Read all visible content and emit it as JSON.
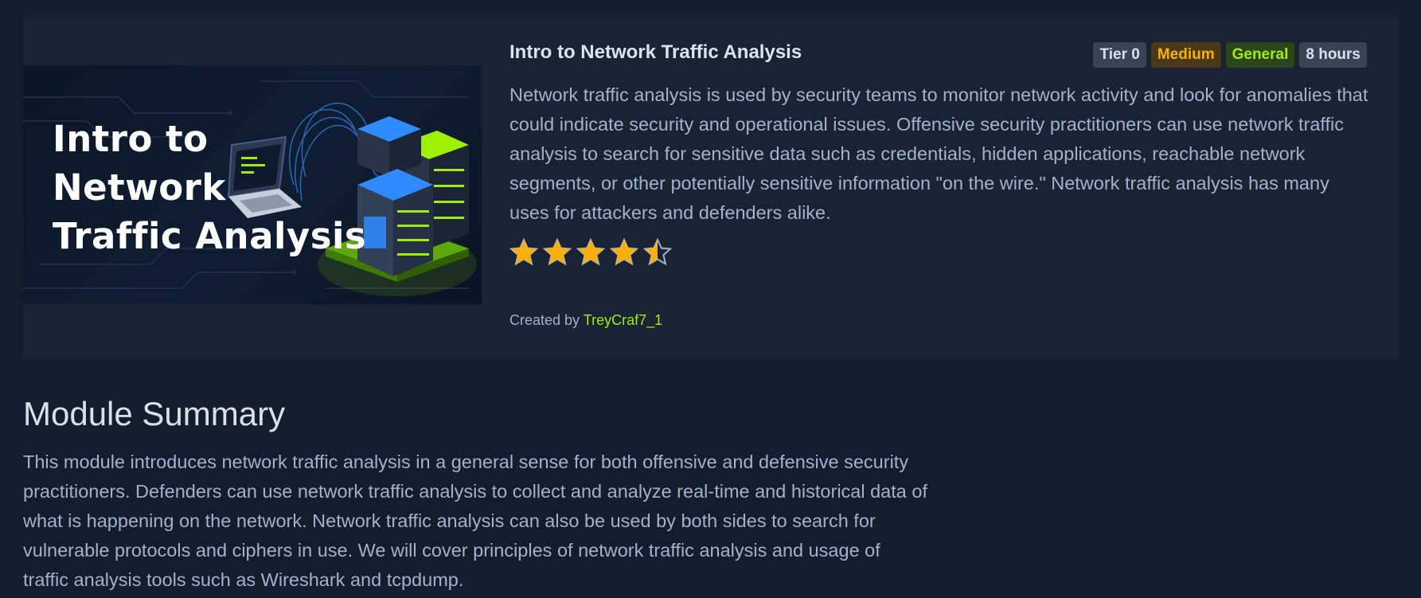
{
  "module": {
    "title": "Intro to Network Traffic Analysis",
    "thumbnail": {
      "line1": "Intro to",
      "line2": "Network",
      "line3": "Traffic Analysis"
    },
    "badges": {
      "tier": "Tier 0",
      "difficulty": "Medium",
      "category": "General",
      "duration": "8 hours"
    },
    "description": "Network traffic analysis is used by security teams to monitor network activity and look for anomalies that could indicate security and operational issues. Offensive security practitioners can use network traffic analysis to search for sensitive data such as credentials, hidden applications, reachable network segments, or other potentially sensitive information \"on the wire.\" Network traffic analysis has many uses for attackers and defenders alike.",
    "rating": 4.5,
    "rating_max": 5,
    "created_by_label": "Created by",
    "author": "TreyCraf7_1"
  },
  "summary": {
    "heading": "Module Summary",
    "text": "This module introduces network traffic analysis in a general sense for both offensive and defensive security practitioners. Defenders can use network traffic analysis to collect and analyze real-time and historical data of what is happening on the network. Network traffic analysis can also be used by both sides to search for vulnerable protocols and ciphers in use. We will cover principles of network traffic analysis and usage of traffic analysis tools such as Wireshark and tcpdump."
  },
  "colors": {
    "background": "#141d2b",
    "card": "#1a2332",
    "star": "#ffaf00",
    "accent_green": "#9fef00",
    "accent_orange": "#ffaf00"
  },
  "icons": {
    "star": "star-icon",
    "thumbnail_art": "server-rack-laptop-illustration"
  }
}
